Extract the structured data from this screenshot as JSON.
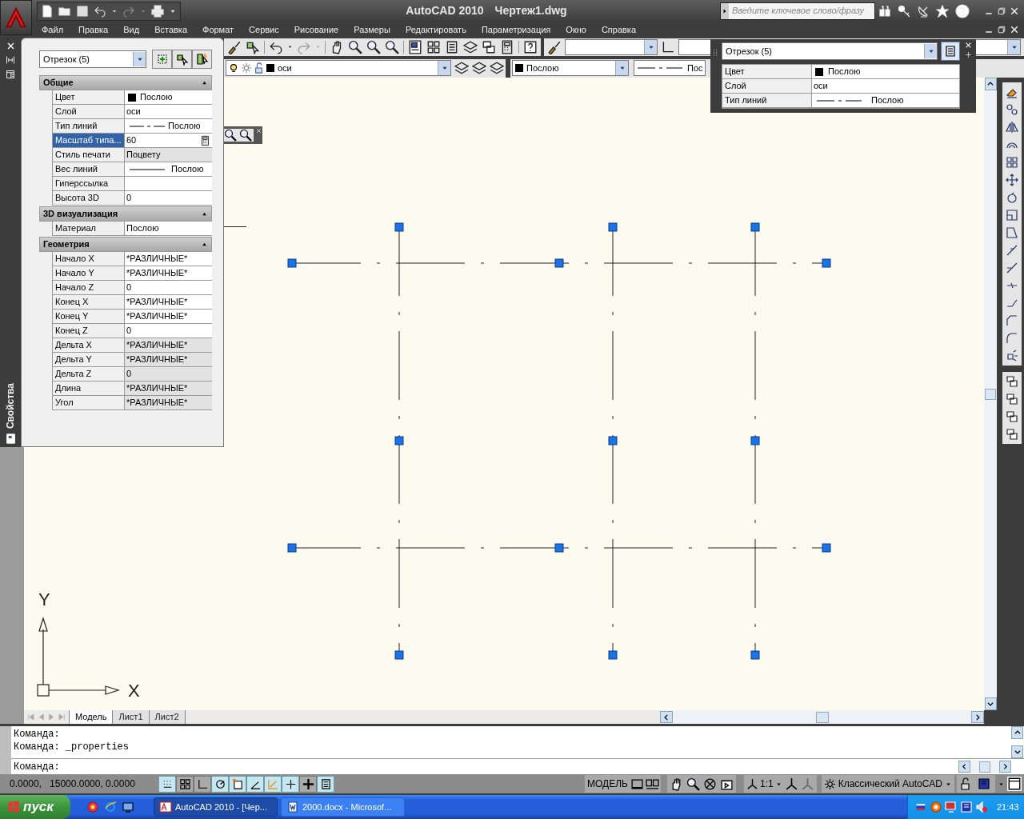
{
  "app_title": "AutoCAD 2010",
  "document_title": "Чертеж1.dwg",
  "search": {
    "placeholder": "Введите ключевое слово/фразу"
  },
  "menu": [
    "Файл",
    "Правка",
    "Вид",
    "Вставка",
    "Формат",
    "Сервис",
    "Рисование",
    "Размеры",
    "Редактировать",
    "Параметризация",
    "Окно",
    "Справка"
  ],
  "layer_toolbar": {
    "layer": "оси",
    "color_setting": "Послою",
    "linetype": "Пос"
  },
  "properties_palette": {
    "title": "Свойства",
    "selection": "Отрезок (5)",
    "sections": [
      {
        "title": "Общие",
        "expanded": true,
        "rows": [
          {
            "label": "Цвет",
            "value": "Послою",
            "kind": "color",
            "selected": false,
            "read_only": false
          },
          {
            "label": "Слой",
            "value": "оси",
            "kind": "text",
            "selected": false,
            "read_only": false
          },
          {
            "label": "Тип линий",
            "value": "Послою",
            "kind": "linetype",
            "selected": false,
            "read_only": false
          },
          {
            "label": "Масштаб типа...",
            "value": "60",
            "kind": "text",
            "selected": true,
            "read_only": false
          },
          {
            "label": "Стиль печати",
            "value": "Поцвету",
            "kind": "text",
            "selected": false,
            "read_only": true
          },
          {
            "label": "Вес линий",
            "value": "Послою",
            "kind": "lineweight",
            "selected": false,
            "read_only": false
          },
          {
            "label": "Гиперссылка",
            "kind": "text",
            "selected": false,
            "read_only": false
          },
          {
            "label": "Высота 3D",
            "value": "0",
            "kind": "text",
            "selected": false,
            "read_only": false
          }
        ]
      },
      {
        "title": "3D визуализация",
        "expanded": true,
        "rows": [
          {
            "label": "Материал",
            "value": "Послою",
            "kind": "text",
            "selected": false,
            "read_only": false
          }
        ]
      },
      {
        "title": "Геометрия",
        "expanded": true,
        "rows": [
          {
            "label": "Начало X",
            "value": "*РАЗЛИЧНЫЕ*",
            "kind": "text",
            "selected": false,
            "read_only": false
          },
          {
            "label": "Начало Y",
            "value": "*РАЗЛИЧНЫЕ*",
            "kind": "text",
            "selected": false,
            "read_only": false
          },
          {
            "label": "Начало Z",
            "value": "0",
            "kind": "text",
            "selected": false,
            "read_only": false
          },
          {
            "label": "Конец X",
            "value": "*РАЗЛИЧНЫЕ*",
            "kind": "text",
            "selected": false,
            "read_only": false
          },
          {
            "label": "Конец Y",
            "value": "*РАЗЛИЧНЫЕ*",
            "kind": "text",
            "selected": false,
            "read_only": false
          },
          {
            "label": "Конец Z",
            "value": "0",
            "kind": "text",
            "selected": false,
            "read_only": false
          },
          {
            "label": "Дельта X",
            "value": "*РАЗЛИЧНЫЕ*",
            "kind": "text",
            "selected": false,
            "read_only": true
          },
          {
            "label": "Дельта Y",
            "value": "*РАЗЛИЧНЫЕ*",
            "kind": "text",
            "selected": false,
            "read_only": true
          },
          {
            "label": "Дельта Z",
            "value": "0",
            "kind": "text",
            "selected": false,
            "read_only": true
          },
          {
            "label": "Длина",
            "value": "*РАЗЛИЧНЫЕ*",
            "kind": "text",
            "selected": false,
            "read_only": true
          },
          {
            "label": "Угол",
            "value": "*РАЗЛИЧНЫЕ*",
            "kind": "text",
            "selected": false,
            "read_only": true
          }
        ]
      }
    ]
  },
  "quick_properties": {
    "selection": "Отрезок (5)",
    "rows": [
      {
        "label": "Цвет",
        "value": "Послою",
        "kind": "color"
      },
      {
        "label": "Слой",
        "value": "оси",
        "kind": "text"
      },
      {
        "label": "Тип линий",
        "value": "Послою",
        "kind": "linetype"
      }
    ]
  },
  "ucs": {
    "x_label": "X",
    "y_label": "Y"
  },
  "layout_tabs": [
    {
      "label": "Модель",
      "selected": true
    },
    {
      "label": "Лист1",
      "selected": false
    },
    {
      "label": "Лист2",
      "selected": false
    }
  ],
  "command_history": [
    "Команда:",
    "Команда: _properties"
  ],
  "command_prompt": "Команда:",
  "status_bar": {
    "readout": "0.0000,   15000.0000, 0.0000",
    "toggles": [
      {
        "on": true
      },
      {
        "on": false
      },
      {
        "on": false
      },
      {
        "on": true
      },
      {
        "on": true
      },
      {
        "on": true
      },
      {
        "on": true
      },
      {
        "on": true
      },
      {
        "on": false
      },
      {
        "on": true
      }
    ],
    "space": "МОДЕЛЬ",
    "scale": "1:1",
    "workspace": "Классический AutoCAD"
  },
  "taskbar": {
    "start": "пуск",
    "tasks": [
      {
        "label": "AutoCAD 2010 - [Чер...",
        "selected": true
      },
      {
        "label": "2000.docx - Microsof...",
        "selected": false
      }
    ],
    "clock": "21:43"
  }
}
